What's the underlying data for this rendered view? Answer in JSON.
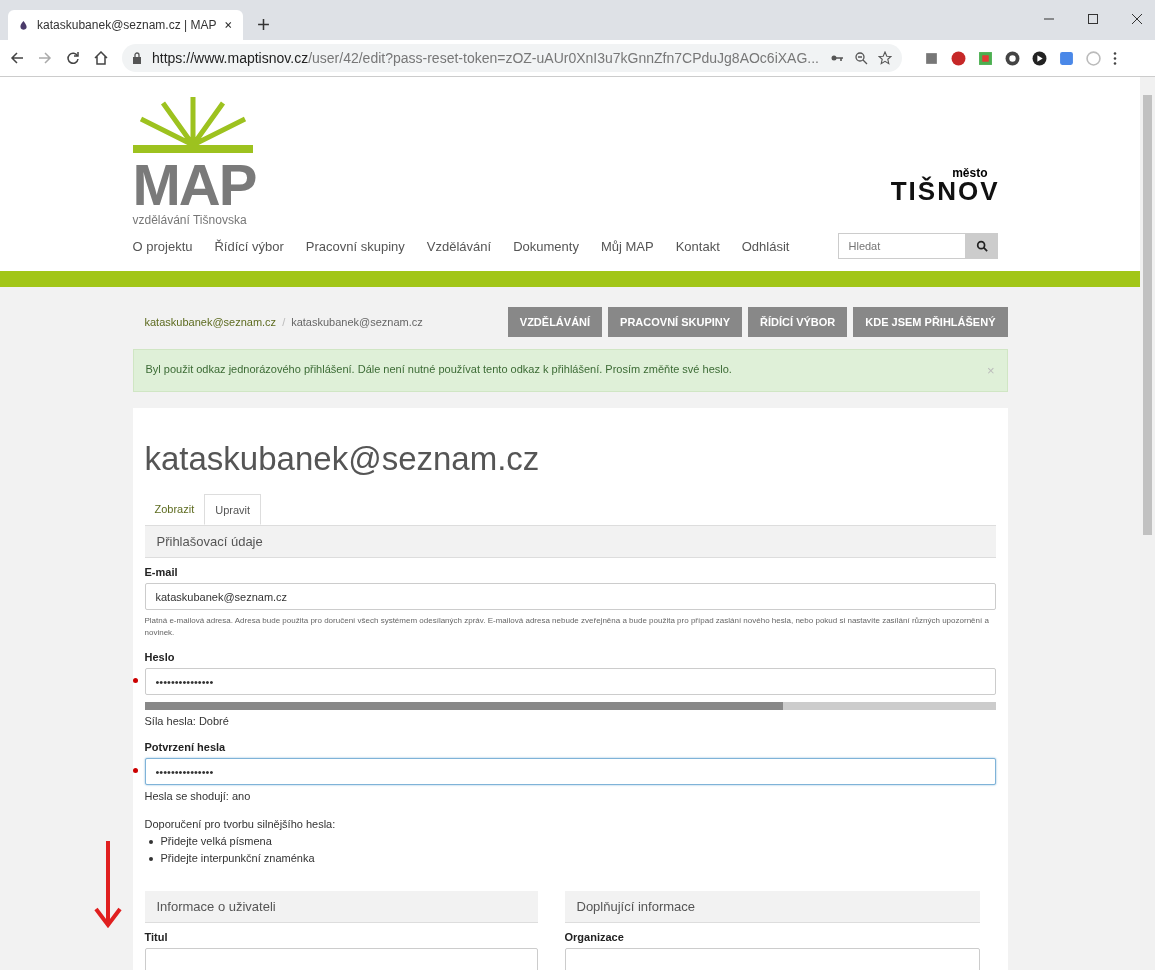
{
  "browser": {
    "tab_title": "kataskubanek@seznam.cz | MAP",
    "url_host": "https://www.maptisnov.cz",
    "url_path": "/user/42/edit?pass-reset-token=zOZ-uAUr0XnI3u7kGnnZfn7CPduJg8AOc6iXAG..."
  },
  "header": {
    "logo_text": "MAP",
    "logo_subtitle": "vzdělávání Tišnovska",
    "town_small": "město",
    "town_name": "TIŠNOV",
    "nav": [
      "O projektu",
      "Řídící výbor",
      "Pracovní skupiny",
      "Vzdělávání",
      "Dokumenty",
      "Můj MAP",
      "Kontakt",
      "Odhlásit"
    ],
    "search": {
      "placeholder": "Hledat"
    }
  },
  "breadcrumb": [
    "kataskubanek@seznam.cz",
    "/",
    "kataskubanek@seznam.cz"
  ],
  "action_buttons": [
    "VZDĚLÁVÁNÍ",
    "PRACOVNÍ SKUPINY",
    "ŘÍDÍCÍ VÝBOR",
    "KDE JSEM PŘIHLÁŠENÝ"
  ],
  "alert": {
    "message": "Byl použit odkaz jednorázového přihlášení. Dále není nutné používat tento odkaz k přihlášení. Prosím změňte své heslo.",
    "close": "×"
  },
  "title": "kataskubanek@seznam.cz",
  "tabs": [
    {
      "label": "Zobrazit",
      "selected": false
    },
    {
      "label": "Upravit",
      "selected": true
    }
  ],
  "section": "Přihlašovací údaje",
  "email": {
    "label": "E-mail",
    "value": "kataskubanek@seznam.cz",
    "help": "Platná e-mailová adresa. Adresa bude použita pro doručení všech systémem odesílaných zpráv. E-mailová adresa nebude zveřejněna a bude použita pro případ zaslání nového hesla, nebo pokud si nastavíte zasílání různých upozornění a novinek."
  },
  "password": {
    "label": "Heslo",
    "value": "•••••••••••••••",
    "required": true,
    "level": 0.75,
    "strength": "Síla hesla: Dobré"
  },
  "confirm": {
    "label": "Potvrzení hesla",
    "value": "•••••••••••••••",
    "required": true,
    "focused": true,
    "match": "Hesla se shodují: ano"
  },
  "recommend": {
    "title": "Doporučení pro tvorbu silnějšího hesla:",
    "items": [
      "Přidejte velká písmena",
      "Přidejte interpunkční znaménka"
    ]
  },
  "columns": [
    {
      "header": "Informace o uživateli",
      "field": "Titul"
    },
    {
      "header": "Doplňující informace",
      "field": "Organizace"
    }
  ]
}
